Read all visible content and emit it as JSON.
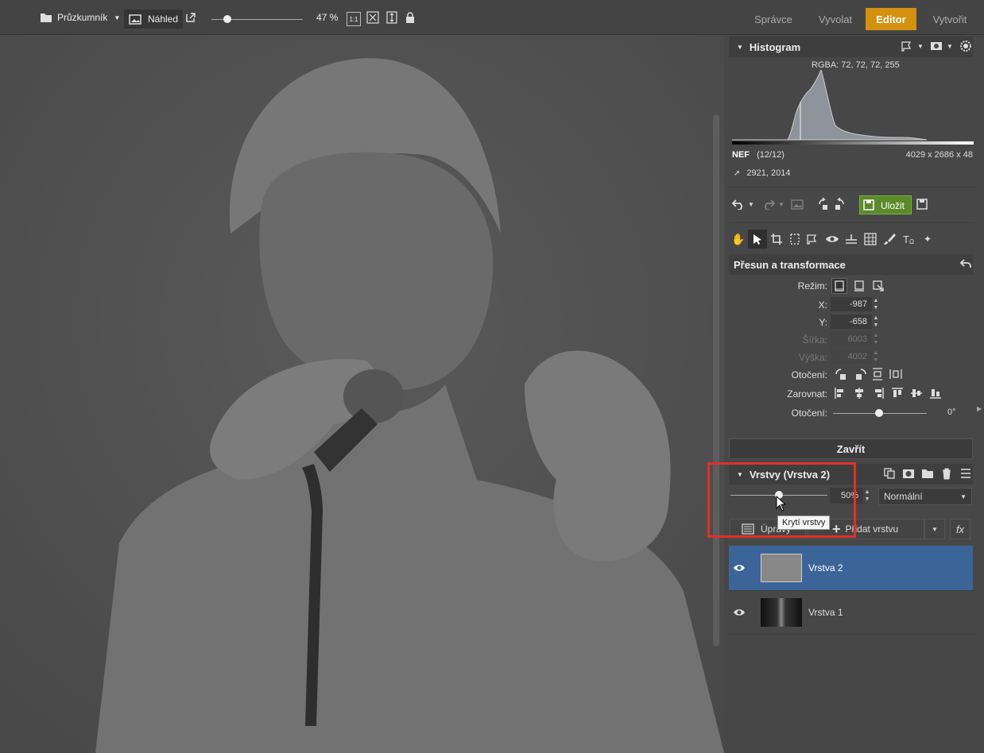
{
  "topbar": {
    "browser_label": "Průzkumník",
    "preview_label": "Náhled",
    "zoom_percent": "47 %",
    "zoom_slider_value": 0.17,
    "ratio_label": "1:1",
    "modes": [
      "Správce",
      "Vyvolat",
      "Editor",
      "Vytvořit"
    ],
    "active_mode": "Editor",
    "accent_color": "#d4910f"
  },
  "histogram": {
    "title": "Histogram",
    "rgba": "RGBA:  72,  72,  72, 255",
    "format": "NEF",
    "count": "(12/12)",
    "dimensions": "4029 x 2686 x 48",
    "cursor_pos": "2921, 2014"
  },
  "toolbar": {
    "save_label": "Uložit",
    "save_color": "#5a8a2a"
  },
  "transform": {
    "title": "Přesun a transformace",
    "mode_label": "Režim:",
    "x_label": "X:",
    "x_value": "-987",
    "y_label": "Y:",
    "y_value": "-658",
    "width_label": "Šířka:",
    "width_value": "6003",
    "height_label": "Výška:",
    "height_value": "4002",
    "rotation_label": "Otočení:",
    "align_label": "Zarovnat:",
    "rotation2_label": "Otočení:",
    "rotation_value": "0°",
    "close_label": "Zavřít"
  },
  "layers": {
    "title": "Vrstvy (Vrstva 2)",
    "opacity_value": "50%",
    "opacity_fraction": 0.5,
    "blend_mode": "Normální",
    "tooltip": "Krytí vrstvy",
    "adjust_label": "Úpravy",
    "add_layer_label": "Přidat vrstvu",
    "fx_label": "fx",
    "items": [
      {
        "name": "Vrstva 2",
        "selected": true
      },
      {
        "name": "Vrstva 1",
        "selected": false
      }
    ]
  },
  "highlight_color": "#e0302a"
}
